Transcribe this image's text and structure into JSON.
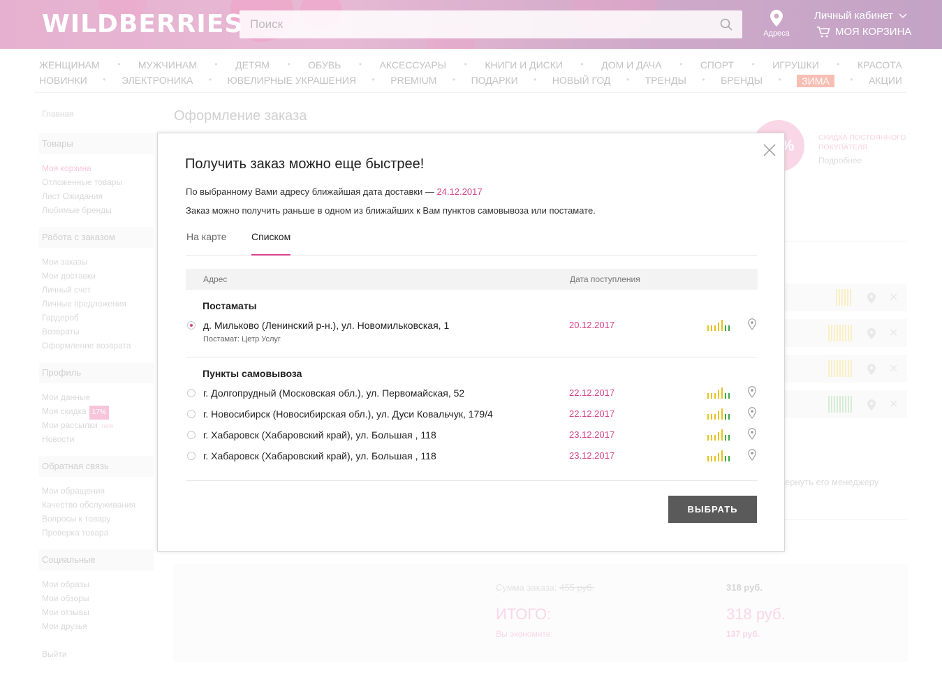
{
  "header": {
    "logo": "WILDBERRIES",
    "search_placeholder": "Поиск",
    "address_label": "Адреса",
    "account_label": "Личный кабинет",
    "cart_label": "МОЯ КОРЗИНА"
  },
  "nav": {
    "row1": [
      "ЖЕНЩИНАМ",
      "МУЖЧИНАМ",
      "ДЕТЯМ",
      "ОБУВЬ",
      "АКСЕССУАРЫ",
      "КНИГИ И ДИСКИ",
      "ДОМ И ДАЧА",
      "СПОРТ",
      "ИГРУШКИ",
      "КРАСОТА"
    ],
    "row2": [
      "НОВИНКИ",
      "ЭЛЕКТРОНИКА",
      "ЮВЕЛИРНЫЕ УКРАШЕНИЯ",
      "PREMIUM",
      "ПОДАРКИ",
      "НОВЫЙ ГОД",
      "ТРЕНДЫ",
      "БРЕНДЫ",
      "ЗИМА",
      "АКЦИИ"
    ]
  },
  "sidebar": {
    "home": "Главная",
    "goods": {
      "title": "Товары",
      "items": [
        "Моя корзина",
        "Отложенные товары",
        "Лист Ожидания",
        "Любимые бренды"
      ]
    },
    "orders": {
      "title": "Работа с заказом",
      "items": [
        "Мои заказы",
        "Мои доставки",
        "Личный счет",
        "Личные предложения",
        "Гардероб",
        "Возвраты",
        "Оформление возврата"
      ]
    },
    "profile": {
      "title": "Профиль",
      "items": [
        "Мои данные",
        "Моя скидка",
        "Мои рассылки",
        "Новости"
      ],
      "discount_badge": "17%",
      "new_badge": "new"
    },
    "feedback": {
      "title": "Обратная связь",
      "items": [
        "Мои обращения",
        "Качество обслуживания",
        "Вопросы к товару",
        "Проверка товара"
      ]
    },
    "social": {
      "title": "Социальные",
      "items": [
        "Мои образы",
        "Мои обзоры",
        "Мои отзывы",
        "Мои друзья"
      ]
    },
    "logout": "Выйти"
  },
  "background": {
    "page_title": "Оформление заказа",
    "promo_line1": "СКИДКА ПОСТОЯННОГО",
    "promo_line2": "ПОКУПАТЕЛЯ",
    "promo_more": "Подробнее",
    "promo_pct": "%",
    "hint": "ернуть его менеджеру",
    "sum_label": "Сумма заказа:",
    "sum_old": "455 руб.",
    "sum_value": "318 руб.",
    "total_label": "ИТОГО:",
    "total_value": "318 руб.",
    "save_label": "Вы экономите:",
    "save_value": "137 руб."
  },
  "modal": {
    "title": "Получить заказ можно еще быстрее!",
    "line1_prefix": "По выбранному Вами адресу ближайшая дата доставки — ",
    "line1_date": "24.12.2017",
    "line2": "Заказ можно получить раньше в одном из ближайших к Вам пунктов самовывоза или постамате.",
    "tabs": [
      "На карте",
      "Списком"
    ],
    "col_address": "Адрес",
    "col_date": "Дата поступления",
    "group1": "Постаматы",
    "group1_rows": [
      {
        "address": "д. Мильково (Ленинский р-н.), ул. Новомильковская, 1",
        "sub": "Постамат: Цетр Услуг",
        "date": "20.12.2017",
        "selected": true
      }
    ],
    "group2": "Пункты самовывоза",
    "group2_rows": [
      {
        "address": "г. Долгопрудный (Московская обл.), ул. Первомайская, 52",
        "date": "22.12.2017",
        "selected": false
      },
      {
        "address": "г. Новосибирск (Новосибирская обл.), ул. Дуси Ковальчук, 179/4",
        "date": "22.12.2017",
        "selected": false
      },
      {
        "address": "г. Хабаровск (Хабаровский край), ул. Большая , 118",
        "date": "23.12.2017",
        "selected": false
      },
      {
        "address": "г. Хабаровск (Хабаровский край), ул. Большая , 118",
        "date": "23.12.2017",
        "selected": false
      }
    ],
    "button": "ВЫБРАТЬ"
  },
  "colors": {
    "accent": "#d6428a",
    "button": "#5a5a5a",
    "bar_yellow": "#e6c21a",
    "bar_green": "#3aa845"
  }
}
